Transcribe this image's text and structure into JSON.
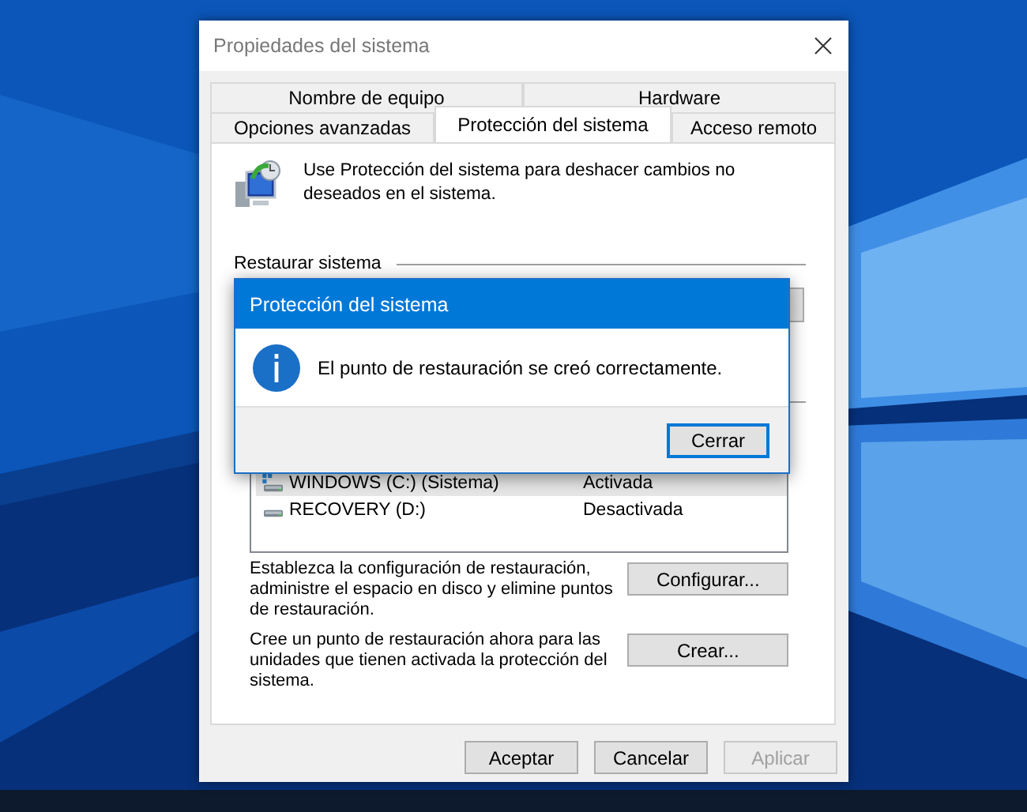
{
  "window": {
    "title": "Propiedades del sistema"
  },
  "tabs_back": [
    {
      "label": "Nombre de equipo",
      "selected": false
    },
    {
      "label": "Hardware",
      "selected": false
    }
  ],
  "tabs_front": [
    {
      "label": "Opciones avanzadas",
      "selected": false
    },
    {
      "label": "Protección del sistema",
      "selected": true
    },
    {
      "label": "Acceso remoto",
      "selected": false
    }
  ],
  "intro": "Use Protección del sistema para deshacer cambios no deseados en el sistema.",
  "restore_group": {
    "title": "Restaurar sistema"
  },
  "drives": [
    {
      "kind": "system",
      "name": "WINDOWS (C:) (Sistema)",
      "protection": "Activada",
      "selected": true
    },
    {
      "kind": "data",
      "name": "RECOVERY (D:)",
      "protection": "Desactivada",
      "selected": false
    }
  ],
  "actions": [
    {
      "text": "Establezca la configuración de restauración, administre el espacio en disco y elimine puntos de restauración.",
      "button": "Configurar..."
    },
    {
      "text": "Cree un punto de restauración ahora para las unidades que tienen activada la protección del sistema.",
      "button": "Crear..."
    }
  ],
  "buttons": [
    {
      "label": "Aceptar",
      "disabled": false
    },
    {
      "label": "Cancelar",
      "disabled": false
    },
    {
      "label": "Aplicar",
      "disabled": true
    }
  ],
  "message_box": {
    "title": "Protección del sistema",
    "text": "El punto de restauración se creó correctamente.",
    "button": "Cerrar"
  }
}
